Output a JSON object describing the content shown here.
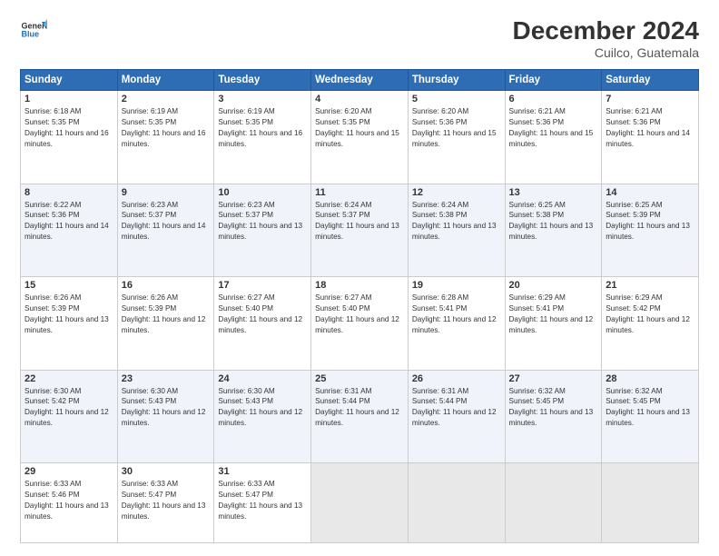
{
  "logo": {
    "line1": "General",
    "line2": "Blue"
  },
  "title": "December 2024",
  "location": "Cuilco, Guatemala",
  "days_header": [
    "Sunday",
    "Monday",
    "Tuesday",
    "Wednesday",
    "Thursday",
    "Friday",
    "Saturday"
  ],
  "weeks": [
    [
      {
        "num": "1",
        "rise": "6:18 AM",
        "set": "5:35 PM",
        "daylight": "11 hours and 16 minutes."
      },
      {
        "num": "2",
        "rise": "6:19 AM",
        "set": "5:35 PM",
        "daylight": "11 hours and 16 minutes."
      },
      {
        "num": "3",
        "rise": "6:19 AM",
        "set": "5:35 PM",
        "daylight": "11 hours and 16 minutes."
      },
      {
        "num": "4",
        "rise": "6:20 AM",
        "set": "5:35 PM",
        "daylight": "11 hours and 15 minutes."
      },
      {
        "num": "5",
        "rise": "6:20 AM",
        "set": "5:36 PM",
        "daylight": "11 hours and 15 minutes."
      },
      {
        "num": "6",
        "rise": "6:21 AM",
        "set": "5:36 PM",
        "daylight": "11 hours and 15 minutes."
      },
      {
        "num": "7",
        "rise": "6:21 AM",
        "set": "5:36 PM",
        "daylight": "11 hours and 14 minutes."
      }
    ],
    [
      {
        "num": "8",
        "rise": "6:22 AM",
        "set": "5:36 PM",
        "daylight": "11 hours and 14 minutes."
      },
      {
        "num": "9",
        "rise": "6:23 AM",
        "set": "5:37 PM",
        "daylight": "11 hours and 14 minutes."
      },
      {
        "num": "10",
        "rise": "6:23 AM",
        "set": "5:37 PM",
        "daylight": "11 hours and 13 minutes."
      },
      {
        "num": "11",
        "rise": "6:24 AM",
        "set": "5:37 PM",
        "daylight": "11 hours and 13 minutes."
      },
      {
        "num": "12",
        "rise": "6:24 AM",
        "set": "5:38 PM",
        "daylight": "11 hours and 13 minutes."
      },
      {
        "num": "13",
        "rise": "6:25 AM",
        "set": "5:38 PM",
        "daylight": "11 hours and 13 minutes."
      },
      {
        "num": "14",
        "rise": "6:25 AM",
        "set": "5:39 PM",
        "daylight": "11 hours and 13 minutes."
      }
    ],
    [
      {
        "num": "15",
        "rise": "6:26 AM",
        "set": "5:39 PM",
        "daylight": "11 hours and 13 minutes."
      },
      {
        "num": "16",
        "rise": "6:26 AM",
        "set": "5:39 PM",
        "daylight": "11 hours and 12 minutes."
      },
      {
        "num": "17",
        "rise": "6:27 AM",
        "set": "5:40 PM",
        "daylight": "11 hours and 12 minutes."
      },
      {
        "num": "18",
        "rise": "6:27 AM",
        "set": "5:40 PM",
        "daylight": "11 hours and 12 minutes."
      },
      {
        "num": "19",
        "rise": "6:28 AM",
        "set": "5:41 PM",
        "daylight": "11 hours and 12 minutes."
      },
      {
        "num": "20",
        "rise": "6:29 AM",
        "set": "5:41 PM",
        "daylight": "11 hours and 12 minutes."
      },
      {
        "num": "21",
        "rise": "6:29 AM",
        "set": "5:42 PM",
        "daylight": "11 hours and 12 minutes."
      }
    ],
    [
      {
        "num": "22",
        "rise": "6:30 AM",
        "set": "5:42 PM",
        "daylight": "11 hours and 12 minutes."
      },
      {
        "num": "23",
        "rise": "6:30 AM",
        "set": "5:43 PM",
        "daylight": "11 hours and 12 minutes."
      },
      {
        "num": "24",
        "rise": "6:30 AM",
        "set": "5:43 PM",
        "daylight": "11 hours and 12 minutes."
      },
      {
        "num": "25",
        "rise": "6:31 AM",
        "set": "5:44 PM",
        "daylight": "11 hours and 12 minutes."
      },
      {
        "num": "26",
        "rise": "6:31 AM",
        "set": "5:44 PM",
        "daylight": "11 hours and 12 minutes."
      },
      {
        "num": "27",
        "rise": "6:32 AM",
        "set": "5:45 PM",
        "daylight": "11 hours and 13 minutes."
      },
      {
        "num": "28",
        "rise": "6:32 AM",
        "set": "5:45 PM",
        "daylight": "11 hours and 13 minutes."
      }
    ],
    [
      {
        "num": "29",
        "rise": "6:33 AM",
        "set": "5:46 PM",
        "daylight": "11 hours and 13 minutes."
      },
      {
        "num": "30",
        "rise": "6:33 AM",
        "set": "5:47 PM",
        "daylight": "11 hours and 13 minutes."
      },
      {
        "num": "31",
        "rise": "6:33 AM",
        "set": "5:47 PM",
        "daylight": "11 hours and 13 minutes."
      },
      null,
      null,
      null,
      null
    ]
  ],
  "labels": {
    "sunrise": "Sunrise:",
    "sunset": "Sunset:",
    "daylight": "Daylight:"
  }
}
